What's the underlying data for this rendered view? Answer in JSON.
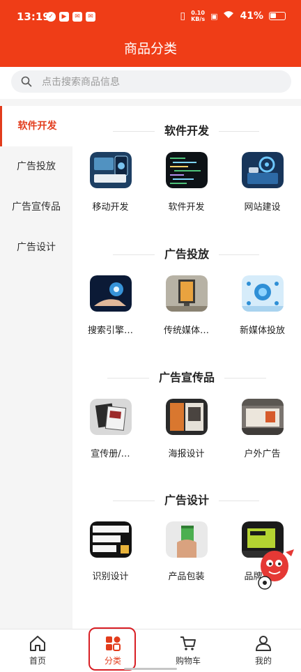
{
  "status": {
    "time": "13:19",
    "netspeed_value": "0.10",
    "netspeed_unit": "KB/s",
    "battery": "41%"
  },
  "header": {
    "title": "商品分类"
  },
  "search": {
    "placeholder": "点击搜索商品信息"
  },
  "sidebar": {
    "items": [
      {
        "label": "软件开发",
        "active": true
      },
      {
        "label": "广告投放",
        "active": false
      },
      {
        "label": "广告宣传品",
        "active": false
      },
      {
        "label": "广告设计",
        "active": false
      }
    ]
  },
  "sections": [
    {
      "title": "软件开发",
      "items": [
        {
          "label": "移动开发"
        },
        {
          "label": "软件开发"
        },
        {
          "label": "网站建设"
        }
      ]
    },
    {
      "title": "广告投放",
      "items": [
        {
          "label": "搜索引擎…"
        },
        {
          "label": "传统媒体…"
        },
        {
          "label": "新媒体投放"
        }
      ]
    },
    {
      "title": "广告宣传品",
      "items": [
        {
          "label": "宣传册/…"
        },
        {
          "label": "海报设计"
        },
        {
          "label": "户外广告"
        }
      ]
    },
    {
      "title": "广告设计",
      "items": [
        {
          "label": "识别设计"
        },
        {
          "label": "产品包装"
        },
        {
          "label": "品牌策划"
        }
      ]
    }
  ],
  "tabbar": {
    "items": [
      {
        "label": "首页",
        "icon": "home-icon"
      },
      {
        "label": "分类",
        "icon": "category-icon"
      },
      {
        "label": "购物车",
        "icon": "cart-icon"
      },
      {
        "label": "我的",
        "icon": "profile-icon"
      }
    ],
    "active_index": 1
  },
  "colors": {
    "accent": "#ef3d17",
    "active_text": "#e23c1c",
    "highlight_border": "#d81e24"
  }
}
